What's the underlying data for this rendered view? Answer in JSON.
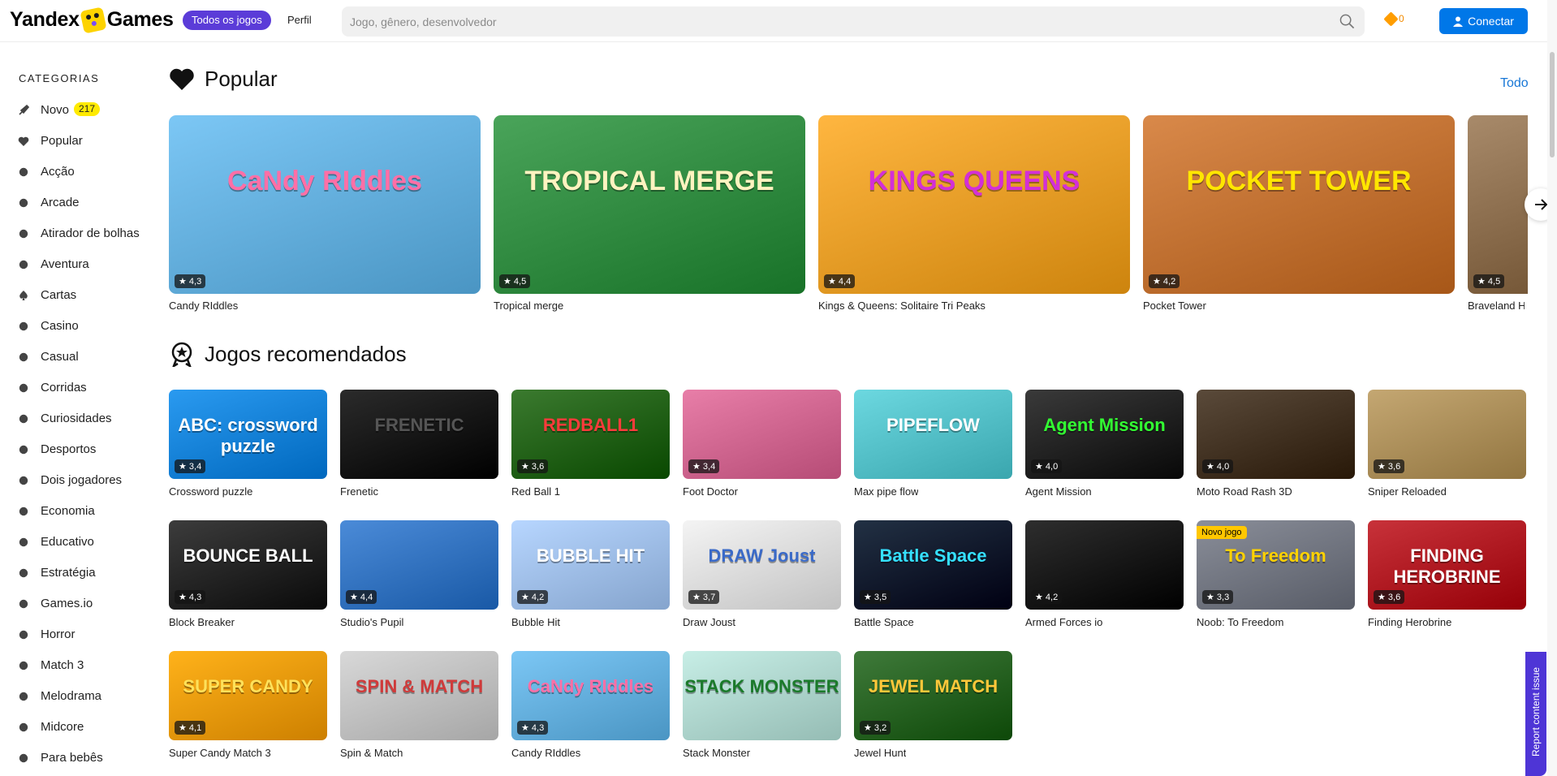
{
  "header": {
    "logo_left": "Yandex",
    "logo_right": "Games",
    "all_games": "Todos os jogos",
    "profile": "Perfil",
    "search_placeholder": "Jogo, gênero, desenvolvedor",
    "coins": "0",
    "connect": "Conectar"
  },
  "sidebar": {
    "title": "CATEGORIAS",
    "items": [
      {
        "label": "Novo",
        "badge": "217",
        "icon": "rocket-icon"
      },
      {
        "label": "Popular",
        "icon": "heart-icon"
      },
      {
        "label": "Acção",
        "icon": "bomb-icon"
      },
      {
        "label": "Arcade",
        "icon": "running-icon"
      },
      {
        "label": "Atirador de bolhas",
        "icon": "bubbles-icon"
      },
      {
        "label": "Aventura",
        "icon": "compass-icon"
      },
      {
        "label": "Cartas",
        "icon": "spade-icon"
      },
      {
        "label": "Casino",
        "icon": "chip-icon"
      },
      {
        "label": "Casual",
        "icon": "cup-icon"
      },
      {
        "label": "Corridas",
        "icon": "speedometer-icon"
      },
      {
        "label": "Curiosidades",
        "icon": "graduation-icon"
      },
      {
        "label": "Desportos",
        "icon": "ball-icon"
      },
      {
        "label": "Dois jogadores",
        "icon": "swords-icon"
      },
      {
        "label": "Economia",
        "icon": "coins-icon"
      },
      {
        "label": "Educativo",
        "icon": "book-icon"
      },
      {
        "label": "Estratégia",
        "icon": "castle-icon"
      },
      {
        "label": "Games.io",
        "icon": "pin-icon"
      },
      {
        "label": "Horror",
        "icon": "ghost-icon"
      },
      {
        "label": "Match 3",
        "icon": "grid-icon"
      },
      {
        "label": "Melodrama",
        "icon": "mask-icon"
      },
      {
        "label": "Midcore",
        "icon": "gear-icon"
      },
      {
        "label": "Para bebês",
        "icon": "baby-icon"
      }
    ]
  },
  "popular": {
    "title": "Popular",
    "all_link": "Todo",
    "games": [
      {
        "name": "Candy RIddles",
        "rating": "★ 4,3",
        "bg": "#7cc7f5",
        "thumb": "CaNdy RIddles",
        "color": "#ff6fa6"
      },
      {
        "name": "Tropical merge",
        "rating": "★ 4,5",
        "bg": "#4aa45a",
        "thumb": "TROPICAL MERGE",
        "color": "#fff3c0"
      },
      {
        "name": "Kings & Queens: Solitaire Tri Peaks",
        "rating": "★ 4,4",
        "bg": "#ffb640",
        "thumb": "KINGS QUEENS",
        "color": "#d32fd8"
      },
      {
        "name": "Pocket Tower",
        "rating": "★ 4,2",
        "bg": "#d9894a",
        "thumb": "POCKET TOWER",
        "color": "#ffe600"
      },
      {
        "name": "Braveland Heroes",
        "rating": "★ 4,5",
        "bg": "#a88a6a",
        "thumb": "",
        "color": "#fff"
      }
    ]
  },
  "recommended": {
    "title": "Jogos recomendados",
    "games": [
      {
        "name": "Crossword puzzle",
        "rating": "★ 3,4",
        "bg": "#2a9af0",
        "thumb": "ABC: crossword puzzle",
        "color": "#fff"
      },
      {
        "name": "Frenetic",
        "rating": "",
        "bg": "#2b2b2b",
        "thumb": "FRENETIC",
        "color": "#555"
      },
      {
        "name": "Red Ball 1",
        "rating": "★ 3,6",
        "bg": "#3b7a2f",
        "thumb": "REDBALL1",
        "color": "#ff3b3b"
      },
      {
        "name": "Foot Doctor",
        "rating": "★ 3,4",
        "bg": "#e87ea8",
        "thumb": "",
        "color": "#fff"
      },
      {
        "name": "Max pipe flow",
        "rating": "",
        "bg": "#6cd8e0",
        "thumb": "PIPEFLOW",
        "color": "#fff"
      },
      {
        "name": "Agent Mission",
        "rating": "★ 4,0",
        "bg": "#3a3a3a",
        "thumb": "Agent Mission",
        "color": "#32ff32"
      },
      {
        "name": "Moto Road Rash 3D",
        "rating": "★ 4,0",
        "bg": "#5a4a3a",
        "thumb": "",
        "color": "#fff"
      },
      {
        "name": "Sniper Reloaded",
        "rating": "★ 3,6",
        "bg": "#c4a772",
        "thumb": "",
        "color": "#fff"
      },
      {
        "name": "Block Breaker",
        "rating": "★ 4,3",
        "bg": "#3c3c3c",
        "thumb": "BOUNCE BALL",
        "color": "#fff"
      },
      {
        "name": "Studio's Pupil",
        "rating": "★ 4,4",
        "bg": "#4b8bd8",
        "thumb": "",
        "color": "#fff"
      },
      {
        "name": "Bubble Hit",
        "rating": "★ 4,2",
        "bg": "#b7d6ff",
        "thumb": "BUBBLE HIT",
        "color": "#fff"
      },
      {
        "name": "Draw Joust",
        "rating": "★ 3,7",
        "bg": "#f4f4f4",
        "thumb": "DRAW Joust",
        "color": "#3a6ac8"
      },
      {
        "name": "Battle Space",
        "rating": "★ 3,5",
        "bg": "#223144",
        "thumb": "Battle Space",
        "color": "#35e0ff"
      },
      {
        "name": "Armed Forces io",
        "rating": "★ 4,2",
        "bg": "#2e2e2e",
        "thumb": "",
        "color": "#fff"
      },
      {
        "name": "Noob: To Freedom",
        "rating": "★ 3,3",
        "bg": "#8a8e99",
        "thumb": "To Freedom",
        "color": "#ffd200",
        "badge": "Novo jogo"
      },
      {
        "name": "Finding Herobrine",
        "rating": "★ 3,6",
        "bg": "#c8323a",
        "thumb": "FINDING HEROBRINE",
        "color": "#fff"
      },
      {
        "name": "Super Candy Match 3",
        "rating": "★ 4,1",
        "bg": "#ffb21a",
        "thumb": "SUPER CANDY",
        "color": "#ffe15a"
      },
      {
        "name": "Spin & Match",
        "rating": "",
        "bg": "#d8d8d8",
        "thumb": "SPIN & MATCH",
        "color": "#d03a3a"
      },
      {
        "name": "Candy RIddles",
        "rating": "★ 4,3",
        "bg": "#7cc7f5",
        "thumb": "CaNdy RIddles",
        "color": "#ff6fa6"
      },
      {
        "name": "Stack Monster",
        "rating": "",
        "bg": "#c7eee6",
        "thumb": "STACK MONSTER",
        "color": "#1a7a2a"
      },
      {
        "name": "Jewel Hunt",
        "rating": "★ 3,2",
        "bg": "#3f7a3a",
        "thumb": "JEWEL MATCH",
        "color": "#ffc83a"
      }
    ]
  },
  "report": "Report content issue"
}
